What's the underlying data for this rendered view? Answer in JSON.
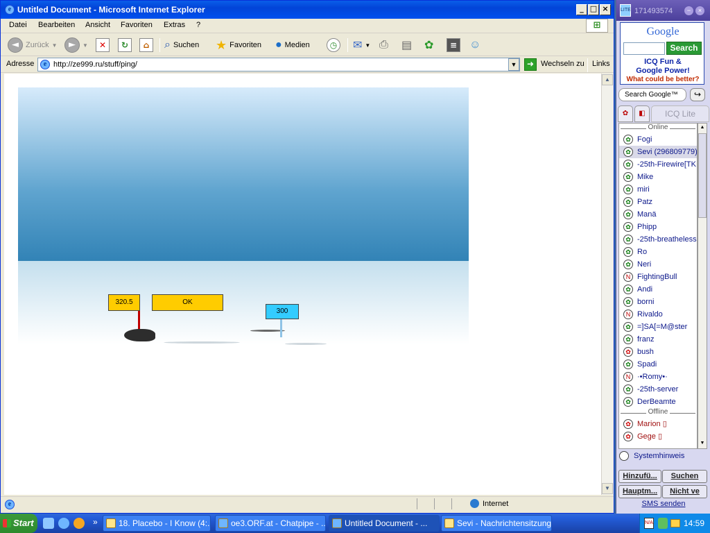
{
  "browser": {
    "title": "Untitled Document - Microsoft Internet Explorer",
    "menu": [
      "Datei",
      "Bearbeiten",
      "Ansicht",
      "Favoriten",
      "Extras",
      "?"
    ],
    "toolbar": {
      "back": "Zurück",
      "search": "Suchen",
      "favorites": "Favoriten",
      "media": "Medien"
    },
    "address": {
      "label": "Adresse",
      "url": "http://ze999.ru/stuff/ping/",
      "go": "Wechseln zu",
      "links": "Links"
    },
    "status": {
      "zone": "Internet"
    }
  },
  "game": {
    "sign_score": "320.5",
    "sign_result": "OK",
    "sign_distance": "300"
  },
  "icq": {
    "uin": "171493574",
    "google": {
      "logo": "Google",
      "button": "Search",
      "line1": "ICQ Fun &",
      "line2": "Google Power!",
      "line3": "What could be better?",
      "searchbar": "Search Google™"
    },
    "tab_label": "ICQ Lite",
    "groups": {
      "online": "Online",
      "offline": "Offline"
    },
    "online": [
      {
        "name": "Fogi"
      },
      {
        "name": "Sevi (296809779)"
      },
      {
        "name": "-25th-Firewire[TK"
      },
      {
        "name": "Mike"
      },
      {
        "name": "miri"
      },
      {
        "name": "Patz"
      },
      {
        "name": "Manä"
      },
      {
        "name": "Phipp"
      },
      {
        "name": "-25th-breatheless"
      },
      {
        "name": "Ro"
      },
      {
        "name": "Neri"
      },
      {
        "name": "FightingBull"
      },
      {
        "name": "Andi"
      },
      {
        "name": "borni"
      },
      {
        "name": "Rivaldo"
      },
      {
        "name": "=]SA[=M@ster"
      },
      {
        "name": "franz"
      },
      {
        "name": "bush"
      },
      {
        "name": "Spadi"
      },
      {
        "name": "·•Romy•·"
      },
      {
        "name": "-25th-server"
      },
      {
        "name": "DerBeamte"
      }
    ],
    "offline": [
      {
        "name": "Marion"
      },
      {
        "name": "Gege"
      }
    ],
    "system_note": "Systemhinweis",
    "buttons": {
      "add": "Hinzufü...",
      "find": "Suchen",
      "main": "Hauptm...",
      "status": "Nicht ve"
    },
    "sms": "SMS senden"
  },
  "taskbar": {
    "start": "Start",
    "tasks": [
      {
        "label": "18. Placebo - I Know (4:..."
      },
      {
        "label": "oe3.ORF.at - Chatpipe - ..."
      },
      {
        "label": "Untitled Document - ..."
      },
      {
        "label": "Sevi - Nachrichtensitzung"
      }
    ],
    "clock": "14:59"
  },
  "colors": {
    "sign_yellow": "#ffcc00",
    "sign_blue": "#33ccff",
    "xp_blue": "#245edb",
    "icq_purple": "#4b3f9b"
  }
}
